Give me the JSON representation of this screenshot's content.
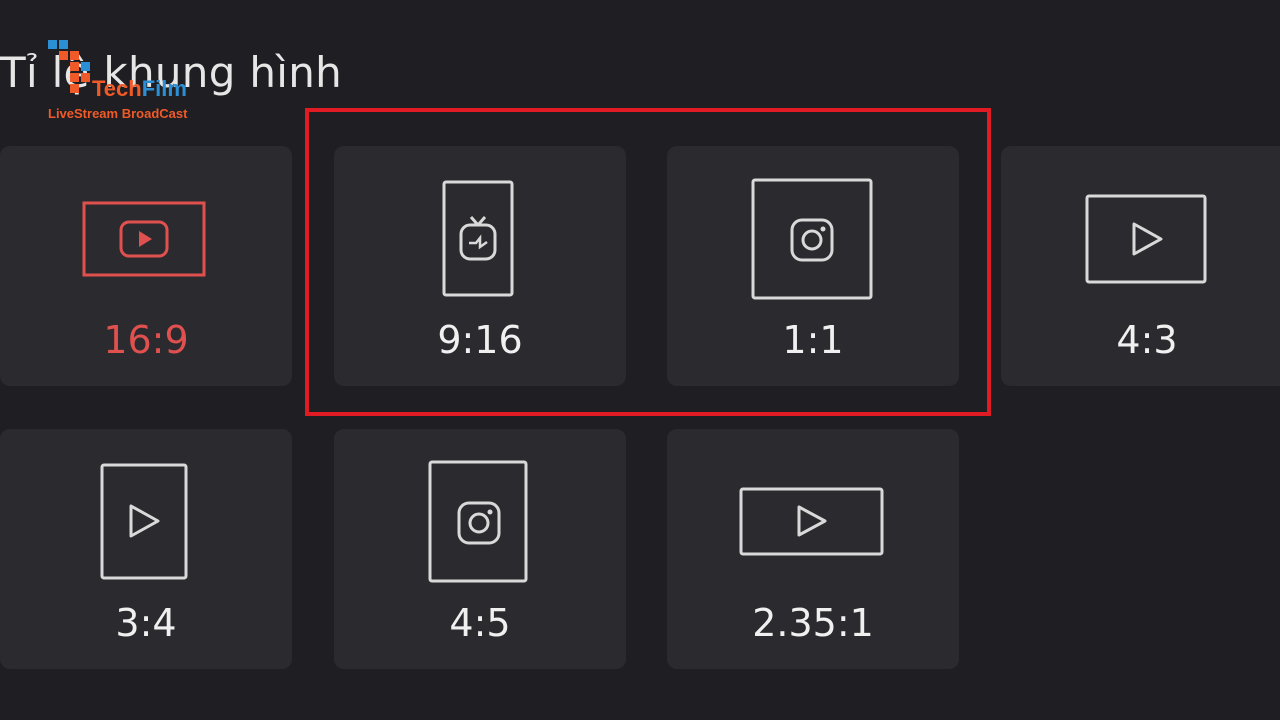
{
  "header": {
    "title": "Tỉ lệ khung hình"
  },
  "logo": {
    "word_part1": "Tech",
    "word_part2": "Film",
    "tagline": "LiveStream BroadCast"
  },
  "ratios": [
    {
      "label": "16:9",
      "icon": "youtube-icon",
      "selected": true
    },
    {
      "label": "9:16",
      "icon": "igtv-icon",
      "selected": false
    },
    {
      "label": "1:1",
      "icon": "instagram-icon",
      "selected": false
    },
    {
      "label": "4:3",
      "icon": "play-icon",
      "selected": false
    },
    {
      "label": "3:4",
      "icon": "play-icon",
      "selected": false
    },
    {
      "label": "4:5",
      "icon": "instagram-icon",
      "selected": false
    },
    {
      "label": "2.35:1",
      "icon": "play-icon",
      "selected": false
    }
  ],
  "colors": {
    "background": "#1f1f23",
    "tile": "#2b2b2f",
    "selected": "#e0504f",
    "icon_stroke": "#d9d9d9",
    "highlight_box": "#e01b24"
  }
}
